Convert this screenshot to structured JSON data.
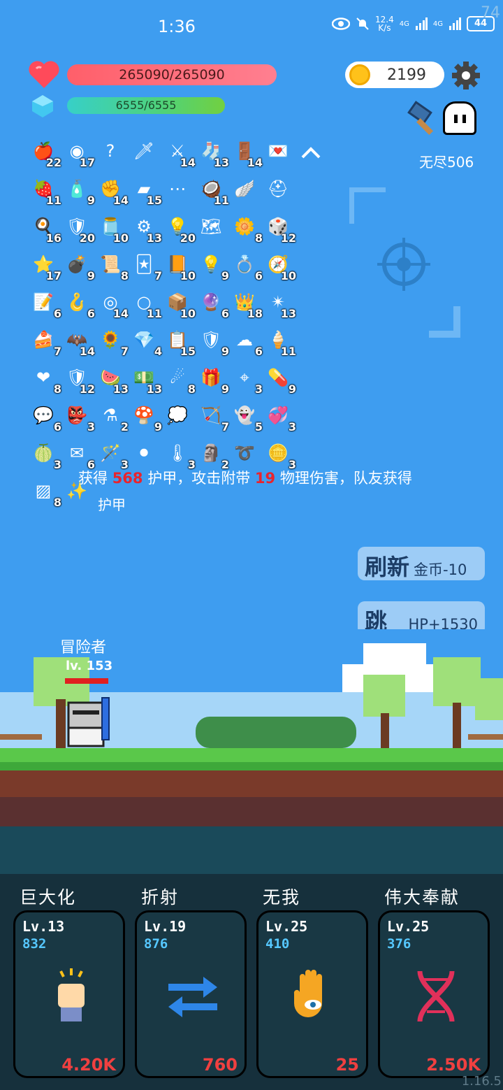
{
  "status": {
    "time": "1:36",
    "net_speed_value": "12.4",
    "net_speed_unit": "K/s",
    "signal1": "4G",
    "signal2": "4G",
    "battery": "44",
    "fps": "74"
  },
  "player": {
    "hp": "265090/265090",
    "mp": "6555/6555",
    "coins": "2199",
    "endless": "无尽506"
  },
  "items": [
    {
      "icon": "apple",
      "glyph": "🍎",
      "count": "22"
    },
    {
      "icon": "shield-wood",
      "glyph": "◉",
      "count": "17"
    },
    {
      "icon": "question",
      "glyph": "?",
      "count": ""
    },
    {
      "icon": "sword",
      "glyph": "🗡",
      "count": ""
    },
    {
      "icon": "big-sword",
      "glyph": "⚔",
      "count": "14"
    },
    {
      "icon": "sock",
      "glyph": "🧦",
      "count": "13"
    },
    {
      "icon": "door",
      "glyph": "🚪",
      "count": "14"
    },
    {
      "icon": "love-letter",
      "glyph": "💌",
      "count": ""
    },
    {
      "icon": "strawberry",
      "glyph": "🍓",
      "count": "11"
    },
    {
      "icon": "spray",
      "glyph": "🧴",
      "count": "9"
    },
    {
      "icon": "fist",
      "glyph": "✊",
      "count": "14"
    },
    {
      "icon": "eraser",
      "glyph": "▰",
      "count": "15"
    },
    {
      "icon": "nodes",
      "glyph": "⋯",
      "count": ""
    },
    {
      "icon": "coconut",
      "glyph": "🥥",
      "count": "11"
    },
    {
      "icon": "wing",
      "glyph": "🪽",
      "count": ""
    },
    {
      "icon": "helmet",
      "glyph": "⛑",
      "count": ""
    },
    {
      "icon": "egg",
      "glyph": "🍳",
      "count": "16"
    },
    {
      "icon": "shield-blue",
      "glyph": "🛡",
      "count": "20"
    },
    {
      "icon": "jar",
      "glyph": "🫙",
      "count": "10"
    },
    {
      "icon": "dumbbell",
      "glyph": "⚙",
      "count": "13"
    },
    {
      "icon": "bulb",
      "glyph": "💡",
      "count": "20"
    },
    {
      "icon": "map",
      "glyph": "🗺",
      "count": ""
    },
    {
      "icon": "flower",
      "glyph": "🌼",
      "count": "8"
    },
    {
      "icon": "dice",
      "glyph": "🎲",
      "count": "12"
    },
    {
      "icon": "star-card",
      "glyph": "⭐",
      "count": "17"
    },
    {
      "icon": "grenade",
      "glyph": "💣",
      "count": "9"
    },
    {
      "icon": "scroll",
      "glyph": "📜",
      "count": "8"
    },
    {
      "icon": "cards",
      "glyph": "🃏",
      "count": "7"
    },
    {
      "icon": "book",
      "glyph": "📙",
      "count": "10"
    },
    {
      "icon": "lightbulb",
      "glyph": "💡",
      "count": "9"
    },
    {
      "icon": "ring",
      "glyph": "💍",
      "count": "6"
    },
    {
      "icon": "compass",
      "glyph": "🧭",
      "count": "10"
    },
    {
      "icon": "note",
      "glyph": "📝",
      "count": "6"
    },
    {
      "icon": "hook",
      "glyph": "🪝",
      "count": "6"
    },
    {
      "icon": "target-ring",
      "glyph": "◎",
      "count": "14"
    },
    {
      "icon": "halo",
      "glyph": "○",
      "count": "11"
    },
    {
      "icon": "box",
      "glyph": "📦",
      "count": "10"
    },
    {
      "icon": "crystal-ball",
      "glyph": "🔮",
      "count": "6"
    },
    {
      "icon": "crown",
      "glyph": "👑",
      "count": "18"
    },
    {
      "icon": "spike-ball",
      "glyph": "✴",
      "count": "13"
    },
    {
      "icon": "flag-cake",
      "glyph": "🍰",
      "count": "7"
    },
    {
      "icon": "bat",
      "glyph": "🦇",
      "count": "14"
    },
    {
      "icon": "sunflower",
      "glyph": "🌻",
      "count": "7"
    },
    {
      "icon": "gem",
      "glyph": "💎",
      "count": "4"
    },
    {
      "icon": "clipboard",
      "glyph": "📋",
      "count": "15"
    },
    {
      "icon": "badge",
      "glyph": "🛡",
      "count": "9"
    },
    {
      "icon": "cloud",
      "glyph": "☁",
      "count": "6"
    },
    {
      "icon": "ice-cream",
      "glyph": "🍦",
      "count": "11"
    },
    {
      "icon": "heart",
      "glyph": "❤",
      "count": "8"
    },
    {
      "icon": "red-shield",
      "glyph": "🛡",
      "count": "12"
    },
    {
      "icon": "watermelon",
      "glyph": "🍉",
      "count": "13"
    },
    {
      "icon": "money",
      "glyph": "💵",
      "count": "13"
    },
    {
      "icon": "meteor",
      "glyph": "☄",
      "count": "8"
    },
    {
      "icon": "gift",
      "glyph": "🎁",
      "count": "9"
    },
    {
      "icon": "crosshair",
      "glyph": "⌖",
      "count": "3"
    },
    {
      "icon": "pill",
      "glyph": "💊",
      "count": "9"
    },
    {
      "icon": "chat-blue",
      "glyph": "💬",
      "count": "6"
    },
    {
      "icon": "goblin",
      "glyph": "👺",
      "count": "3"
    },
    {
      "icon": "flask",
      "glyph": "⚗",
      "count": "2"
    },
    {
      "icon": "mushroom",
      "glyph": "🍄",
      "count": "9"
    },
    {
      "icon": "chat-white",
      "glyph": "💭",
      "count": ""
    },
    {
      "icon": "bow",
      "glyph": "🏹",
      "count": "7"
    },
    {
      "icon": "ghost",
      "glyph": "👻",
      "count": "5"
    },
    {
      "icon": "hearts",
      "glyph": "💞",
      "count": "3"
    },
    {
      "icon": "lime",
      "glyph": "🍈",
      "count": "3"
    },
    {
      "icon": "envelope",
      "glyph": "✉",
      "count": "6"
    },
    {
      "icon": "wand",
      "glyph": "🪄",
      "count": "3"
    },
    {
      "icon": "cauldron",
      "glyph": "⚫",
      "count": ""
    },
    {
      "icon": "thermometer",
      "glyph": "🌡",
      "count": "3"
    },
    {
      "icon": "totem",
      "glyph": "🗿",
      "count": "2"
    },
    {
      "icon": "noose",
      "glyph": "➰",
      "count": ""
    },
    {
      "icon": "coins",
      "glyph": "🪙",
      "count": "3"
    },
    {
      "icon": "striped-box",
      "glyph": "▨",
      "count": "8"
    },
    {
      "icon": "bright-bulb",
      "glyph": "✨",
      "count": ""
    }
  ],
  "message": {
    "prefix": "获得",
    "armor": "568",
    "mid": "护甲，攻击附带",
    "dmg": "19",
    "suffix": "物理伤害，队友获得",
    "line2": "护甲"
  },
  "buttons": {
    "refresh_main": "刷新",
    "refresh_sub": "金币-10",
    "skip_main": "跳过",
    "skip_sub": "HP+1530"
  },
  "hero": {
    "name": "冒险者",
    "level": "lv. 153"
  },
  "skills": [
    {
      "title": "巨大化",
      "lv": "Lv.13",
      "value": "832",
      "cost": "4.20K",
      "icon": "fist-icon"
    },
    {
      "title": "折射",
      "lv": "Lv.19",
      "value": "876",
      "cost": "760",
      "icon": "arrows-icon"
    },
    {
      "title": "无我",
      "lv": "Lv.25",
      "value": "410",
      "cost": "25",
      "icon": "hamsa-eye-icon"
    },
    {
      "title": "伟大奉献",
      "lv": "Lv.25",
      "value": "376",
      "cost": "2.50K",
      "icon": "dna-icon"
    }
  ],
  "version": "1.16.5",
  "colors": {
    "sky": "#3e9df0",
    "hp": "#ff6a7a",
    "mp": "#4fd27a",
    "panel": "#16303c",
    "cost": "#f04040",
    "skill_value": "#56c8ff"
  }
}
